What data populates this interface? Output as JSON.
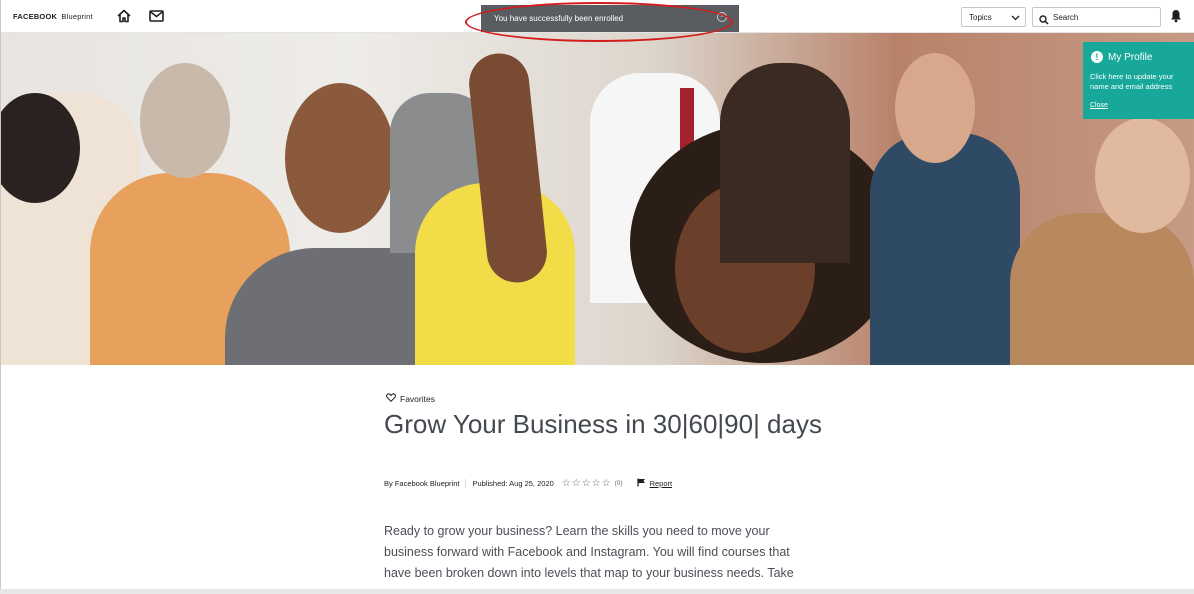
{
  "brand": {
    "name": "FACEBOOK",
    "product": "Blueprint"
  },
  "nav": {
    "home_icon": "home-icon",
    "mail_icon": "mail-icon"
  },
  "toast": {
    "message": "You have successfully been enrolled",
    "close_icon": "close-icon"
  },
  "header": {
    "topics_label": "Topics",
    "search_placeholder": "Search"
  },
  "profile_card": {
    "title": "My Profile",
    "badge": "!",
    "body": "Click here to update your name and email address",
    "close_label": "Close",
    "color": "#17a89a"
  },
  "course": {
    "favorites_label": "Favorites",
    "title": "Grow Your Business in 30|60|90| days",
    "author": "By Facebook Blueprint",
    "published": "Published: Aug 25, 2020",
    "rating_stars": "☆☆☆☆☆",
    "rating_count": "(0)",
    "report_label": "Report",
    "description": "Ready to grow your business? Learn the skills you need to move your business forward with Facebook and Instagram. You will find courses that have been broken down into levels that map to your business needs. Take"
  },
  "colors": {
    "toast_bg": "#595c60",
    "highlight": "#d41c1c"
  }
}
